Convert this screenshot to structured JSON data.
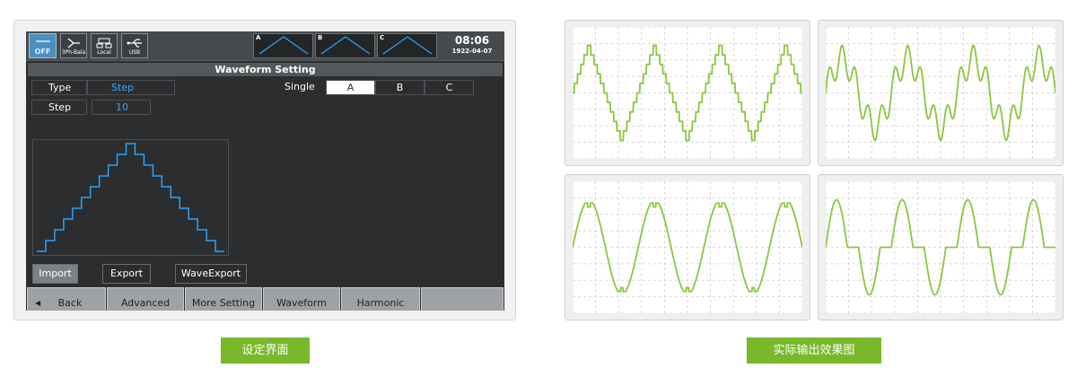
{
  "device": {
    "status": {
      "power_label": "OFF",
      "phase_label": "3Ph-Bala",
      "local_label": "Local",
      "usb_label": "USB",
      "thumbs": [
        "A",
        "B",
        "C"
      ],
      "time": "08:06",
      "date": "1922-04-07"
    },
    "title": "Waveform Setting",
    "type_label": "Type",
    "type_value": "Step",
    "step_label": "Step",
    "step_value": "10",
    "single_label": "Single",
    "phase_options": [
      "A",
      "B",
      "C"
    ],
    "selected_phase": "A",
    "actions": [
      "Import",
      "Export",
      "WaveExport"
    ],
    "active_action": "Import",
    "bottom_nav": {
      "back": "Back",
      "advanced": "Advanced",
      "more_setting": "More Setting",
      "waveform": "Waveform",
      "harmonic": "Harmonic",
      "blank": ""
    },
    "step_preview_levels": [
      0,
      1,
      2,
      3,
      4,
      5,
      6,
      7,
      8,
      9,
      10,
      9,
      8,
      7,
      6,
      5,
      4,
      3,
      2,
      1,
      0
    ],
    "colors": {
      "screen_bg": "#2b2d2e",
      "accent_blue": "#3aa8ff",
      "wave_blue": "#2aa3ff"
    }
  },
  "captions": {
    "left": "设定界面",
    "right": "实际输出效果图"
  },
  "output_panels": [
    {
      "shape": "stepped-triangle",
      "color": "#8dc63f"
    },
    {
      "shape": "harmonic-distorted-sine",
      "color": "#8dc63f"
    },
    {
      "shape": "clipped-sine-with-notches",
      "color": "#8dc63f"
    },
    {
      "shape": "pulse-with-flat-zero",
      "color": "#8dc63f"
    }
  ]
}
